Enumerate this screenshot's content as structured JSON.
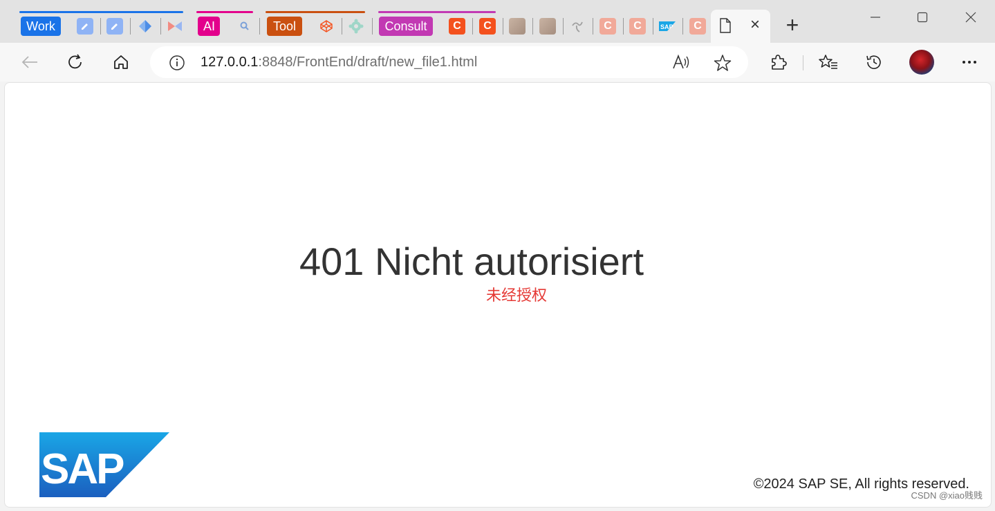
{
  "tabs": {
    "groups": [
      {
        "label": "Work",
        "color": "#1a73e8"
      },
      {
        "label": "AI",
        "color": "#e3008c"
      },
      {
        "label": "Tool",
        "color": "#ca5010"
      },
      {
        "label": "Consult",
        "color": "#c239b3"
      }
    ],
    "active_tab_close": "×",
    "new_tab": "+"
  },
  "window_controls": {
    "minimize": "—",
    "maximize": "□",
    "close": "✕"
  },
  "address_bar": {
    "url_host": "127.0.0.1",
    "url_rest": ":8848/FrontEnd/draft/new_file1.html"
  },
  "page": {
    "error_title": "401 Nicht autorisiert",
    "error_subtitle": "未经授权",
    "logo_text": "SAP",
    "copyright": "©2024 SAP SE, All rights reserved.",
    "watermark": "CSDN @xiao贱贱"
  },
  "colors": {
    "error_red": "#e53935",
    "sap_blue_top": "#1aa6e6",
    "sap_blue_bottom": "#1b5fbf",
    "favicon_orange": "#f4511e"
  }
}
